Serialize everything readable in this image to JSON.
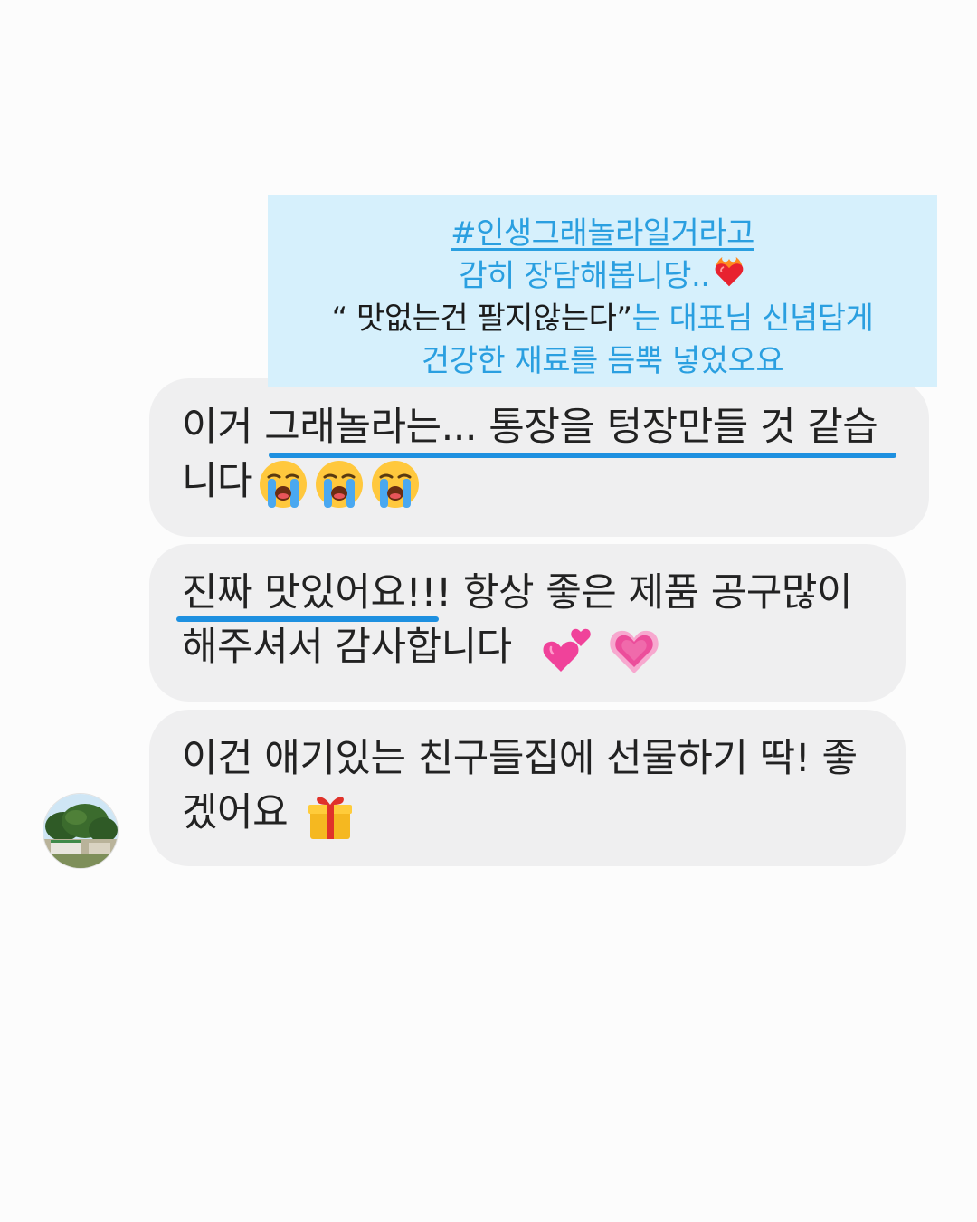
{
  "caption": {
    "hashtag": "#인생그래놀라일거라고",
    "line2": "감히 장담해봅니당..",
    "quote_part": "“ 맛없는건 팔지않는다”",
    "line3_rest": "는 대표님 신념답게",
    "line4": "건강한 재료를 듬뿍 넣었오요",
    "line2_emoji": "heart-on-fire-emoji"
  },
  "messages": [
    {
      "line1": "이거 그래놀라는... 통장을 텅장만들 것 같습",
      "line2": "니다",
      "emojis": [
        "loudly-crying-face-emoji",
        "loudly-crying-face-emoji",
        "loudly-crying-face-emoji"
      ]
    },
    {
      "line1": "진짜 맛있어요!!! 항상 좋은 제품 공구많이",
      "line2": "해주셔서 감사합니다",
      "emojis": [
        "two-hearts-emoji",
        "growing-heart-emoji"
      ]
    },
    {
      "line1": "이건 애기있는 친구들집에 선물하기 딱! 좋",
      "line2": "겠어요",
      "emojis": [
        "wrapped-gift-emoji"
      ]
    }
  ],
  "colors": {
    "background": "#fcfcfc",
    "caption_bg": "#d6f0fc",
    "caption_text": "#2a9fe0",
    "bubble": "#efeff0",
    "underline": "#1e90e0"
  }
}
